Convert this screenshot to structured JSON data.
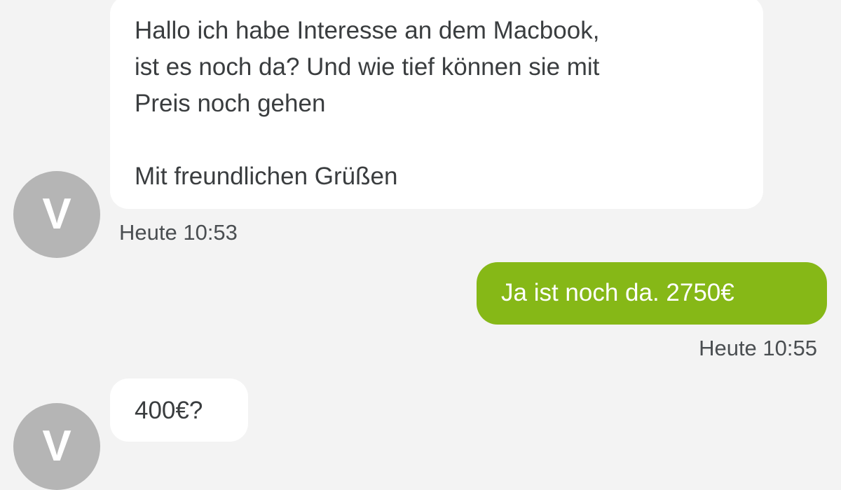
{
  "messages": [
    {
      "direction": "incoming",
      "text": "Hallo ich habe Interesse an dem Macbook,\nist es noch da? Und wie tief können sie mit\nPreis noch gehen\n\nMit freundlichen Grüßen",
      "time": "Heute 10:53",
      "avatar_initial": "V"
    },
    {
      "direction": "outgoing",
      "text": "Ja ist noch da. 2750€",
      "time": "Heute 10:55"
    },
    {
      "direction": "incoming",
      "text": "400€?",
      "avatar_initial": "V"
    }
  ],
  "colors": {
    "background": "#f3f3f3",
    "incoming_bubble": "#ffffff",
    "outgoing_bubble": "#86b817",
    "avatar": "#b5b5b5",
    "text": "#3a3d3f",
    "timestamp": "#4a4e51"
  }
}
